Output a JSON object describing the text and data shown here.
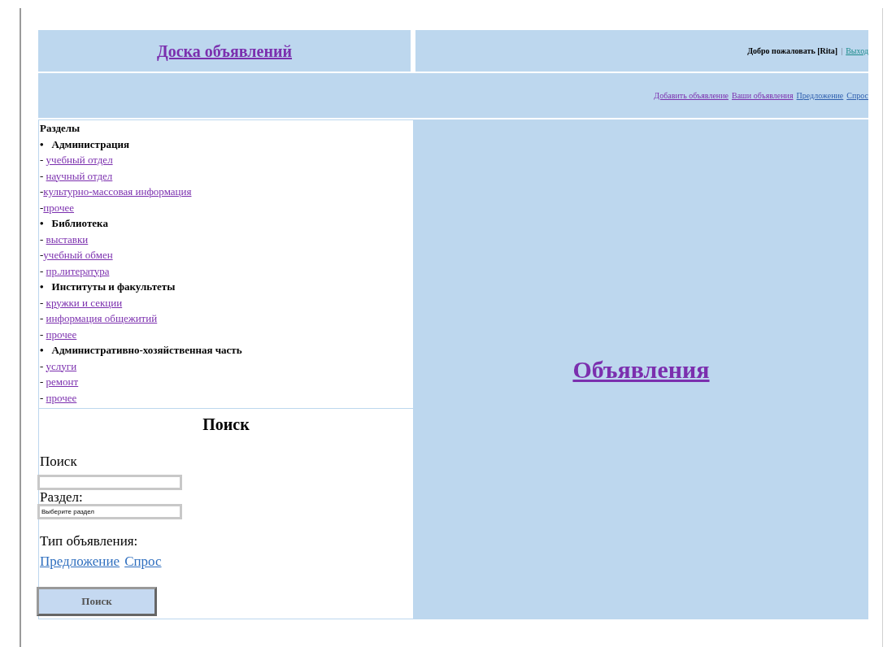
{
  "header": {
    "title": "Доска объявлений",
    "welcome": "Добро пожаловать [Rita]",
    "separator": "|",
    "logout": "Выход"
  },
  "nav": [
    {
      "label": "Добавить объявление",
      "visited": true
    },
    {
      "label": "Ваши объявления",
      "visited": true
    },
    {
      "label": "Предложение",
      "visited": false
    },
    {
      "label": "Спрос",
      "visited": false
    }
  ],
  "sidebar": {
    "title": "Разделы",
    "groups": [
      {
        "bullet": "•",
        "label": "Администрация",
        "children": [
          {
            "prefix": "- ",
            "label": "учебный отдел"
          },
          {
            "prefix": "- ",
            "label": "научный отдел"
          },
          {
            "prefix": "-",
            "label": "культурно-массовая информация"
          },
          {
            "prefix": "-",
            "label": "прочее"
          }
        ]
      },
      {
        "bullet": "•",
        "label": "Библиотека",
        "children": [
          {
            "prefix": "- ",
            "label": "выставки"
          },
          {
            "prefix": "-",
            "label": "учебный обмен"
          },
          {
            "prefix": "- ",
            "label": "пр.литература"
          }
        ]
      },
      {
        "bullet": "•",
        "label": "Институты и факультеты",
        "children": [
          {
            "prefix": "- ",
            "label": "кружки и секции"
          },
          {
            "prefix": "- ",
            "label": "информация общежитий"
          },
          {
            "prefix": "- ",
            "label": "прочее"
          }
        ]
      },
      {
        "bullet": "•",
        "label": "Административно-хозяйственная часть",
        "children": [
          {
            "prefix": "- ",
            "label": "услуги"
          },
          {
            "prefix": "- ",
            "label": "ремонт"
          },
          {
            "prefix": "- ",
            "label": "прочее"
          }
        ]
      }
    ]
  },
  "search": {
    "title": "Поиск",
    "query_label": "Поиск",
    "section_label": "Раздел:",
    "section_value": "Выберите раздел",
    "type_label": "Тип объявления:",
    "type_links": [
      "Предложение",
      "Спрос"
    ],
    "button": "Поиск"
  },
  "main": {
    "title": "Объявления"
  }
}
